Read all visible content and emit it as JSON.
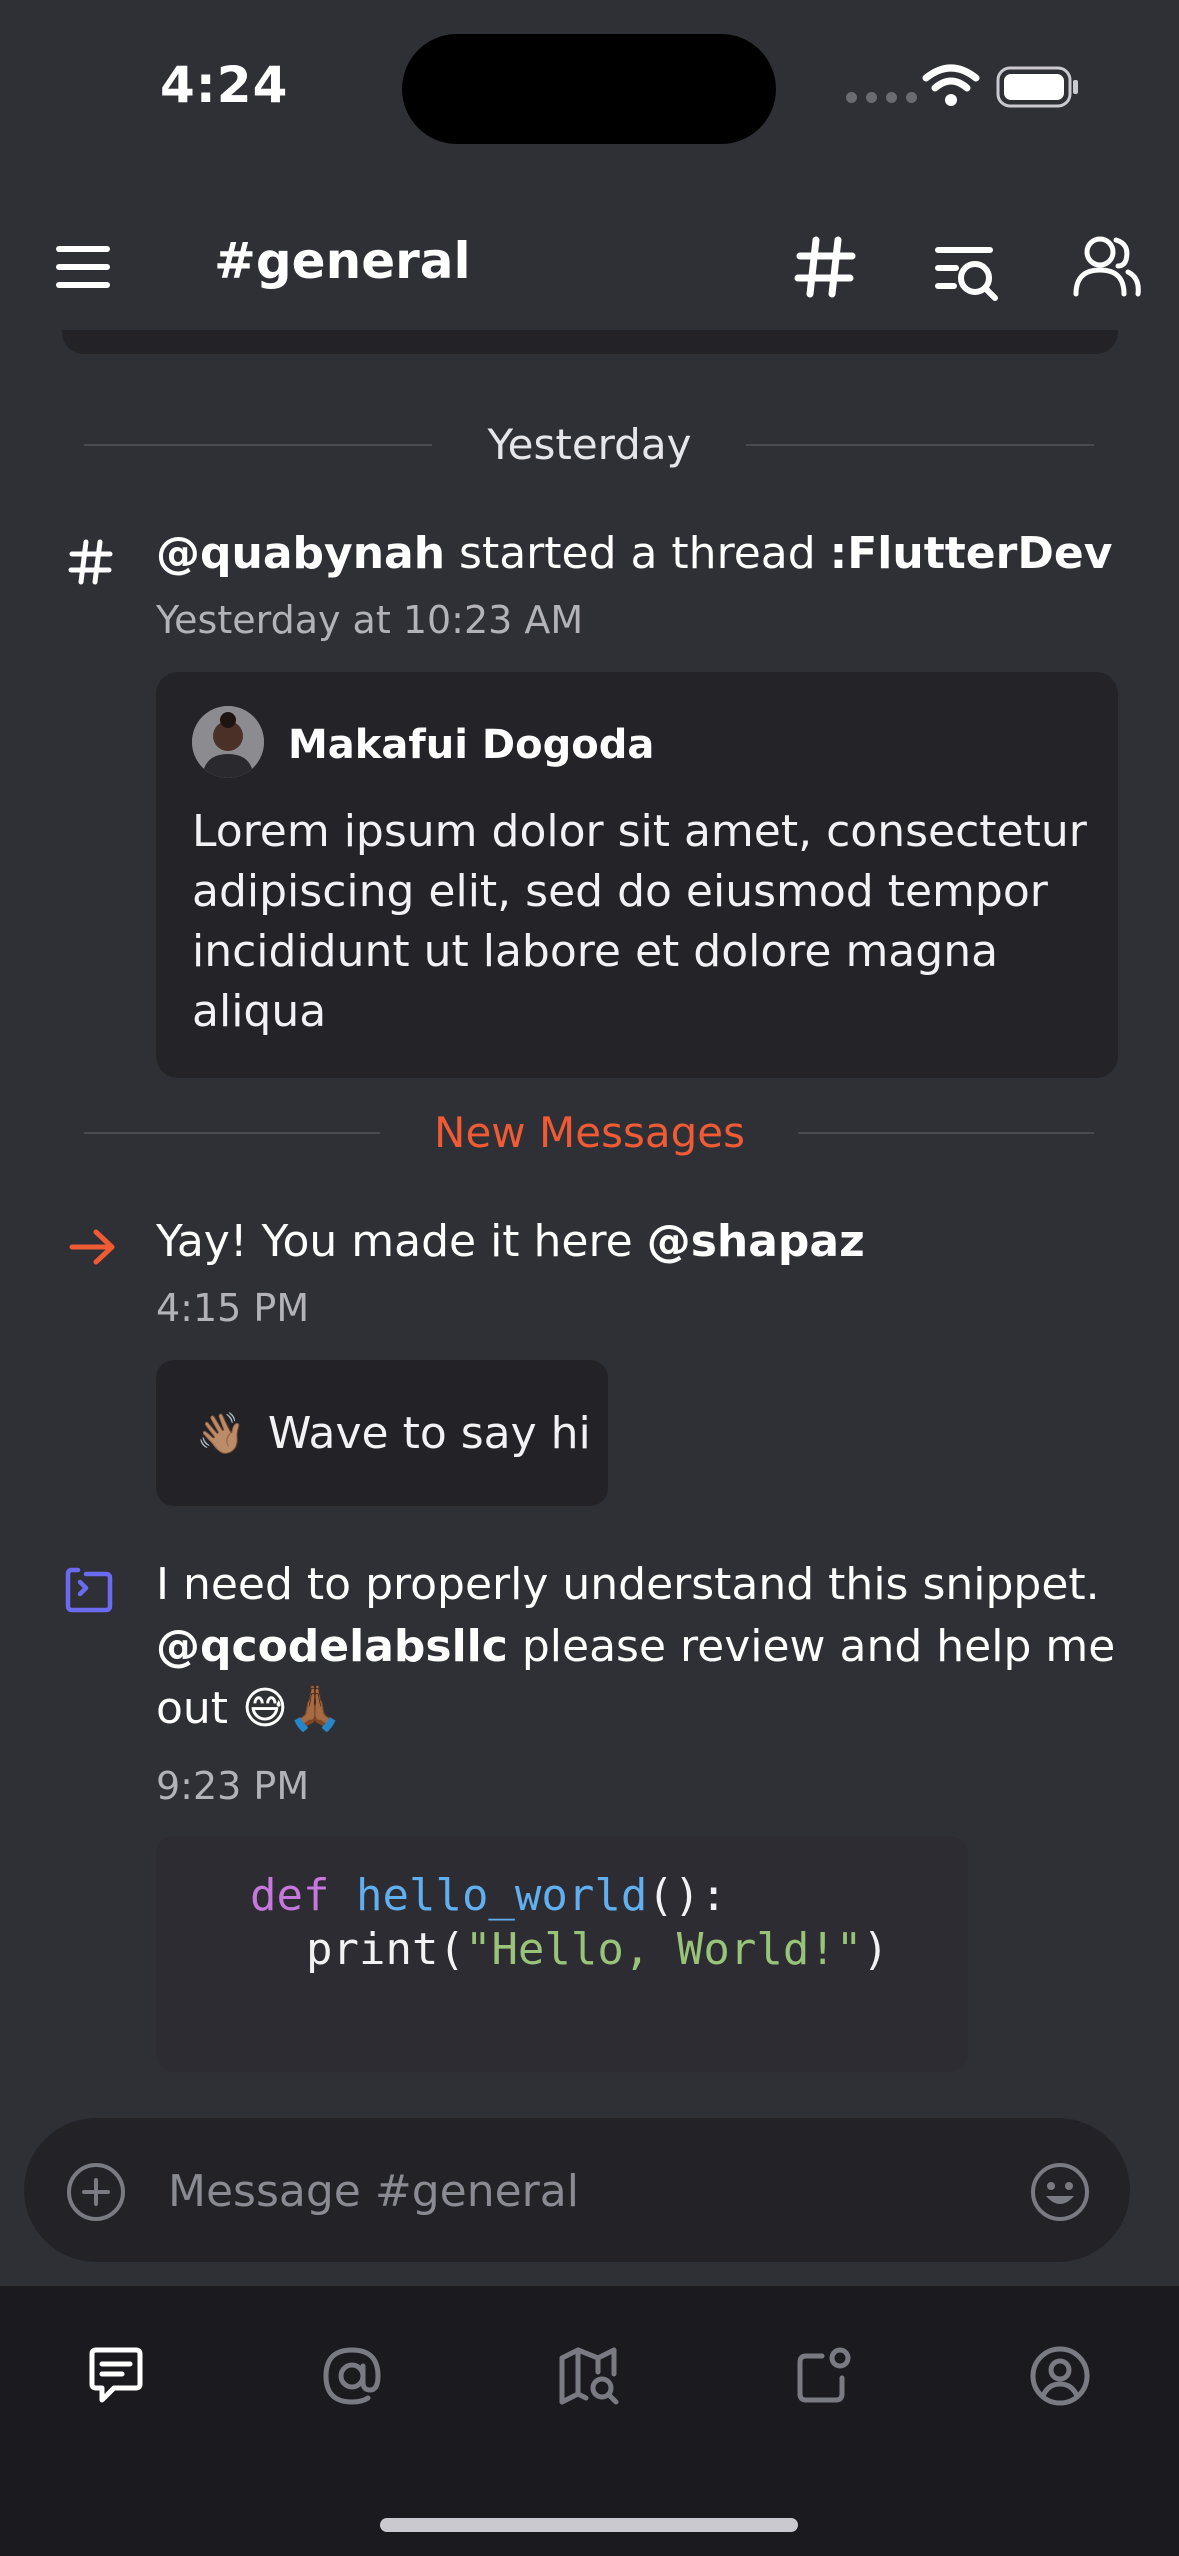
{
  "status_bar": {
    "time": "4:24"
  },
  "header": {
    "title": "#general"
  },
  "dividers": {
    "yesterday": "Yesterday",
    "new_messages": "New Messages"
  },
  "thread_message": {
    "user": "@quabynah",
    "action": " started a thread ",
    "thread_name": ":FlutterDev",
    "time": "Yesterday at 10:23 AM",
    "quote": {
      "author": "Makafui Dogoda",
      "body": "Lorem ipsum dolor sit amet, consectetur adipiscing elit, sed do eiusmod tempor incididunt ut labore et dolore magna aliqua"
    }
  },
  "welcome_message": {
    "text": "Yay! You made it here ",
    "mention": "@shapaz",
    "time": "4:15 PM",
    "wave_emoji": "👋🏽",
    "wave_label": "Wave to say hi"
  },
  "snippet_message": {
    "line1": "I need to properly understand this snippet.",
    "mention": "@qcodelabsllc",
    "line2": " please review and help me",
    "line3": "out 😅🙏🏾",
    "time": "9:23 PM",
    "code": {
      "keyword": "def",
      "function": "hello_world",
      "parens": "():",
      "print": "print(",
      "string": "\"Hello, World!\"",
      "close": ")"
    }
  },
  "composer": {
    "placeholder": "Message #general"
  },
  "colors": {
    "background": "#2f2f36",
    "accent": "#ee5b34",
    "tabbar": "#1b1b1f",
    "card": "#232328"
  }
}
